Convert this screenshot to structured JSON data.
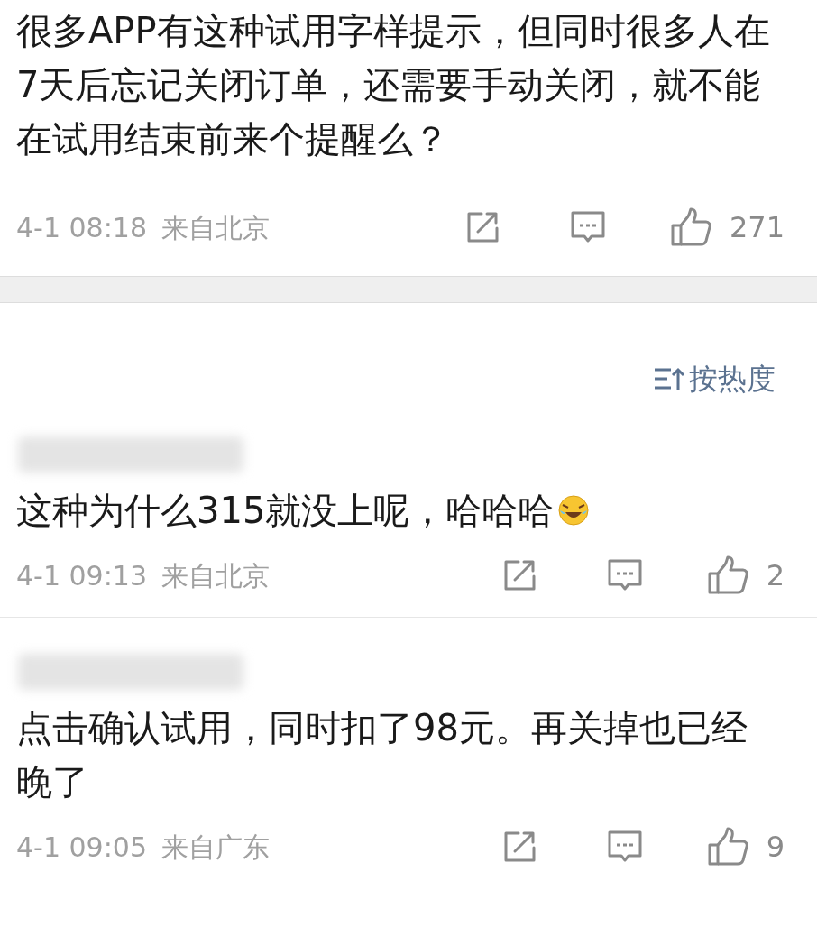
{
  "post": {
    "text": "很多APP有这种试用字样提示，但同时很多人在7天后忘记关闭订单，还需要手动关闭，就不能在试用结束前来个提醒么？",
    "time": "4-1 08:18",
    "location": "来自北京",
    "likes": "271"
  },
  "sort": {
    "label": "按热度"
  },
  "comments": [
    {
      "text": "这种为什么315就没上呢，哈哈哈",
      "emoji": true,
      "time": "4-1 09:13",
      "location": "来自北京",
      "likes": "2"
    },
    {
      "text": "点击确认试用，同时扣了98元。再关掉也已经晚了",
      "emoji": false,
      "time": "4-1 09:05",
      "location": "来自广东",
      "likes": "9"
    }
  ]
}
